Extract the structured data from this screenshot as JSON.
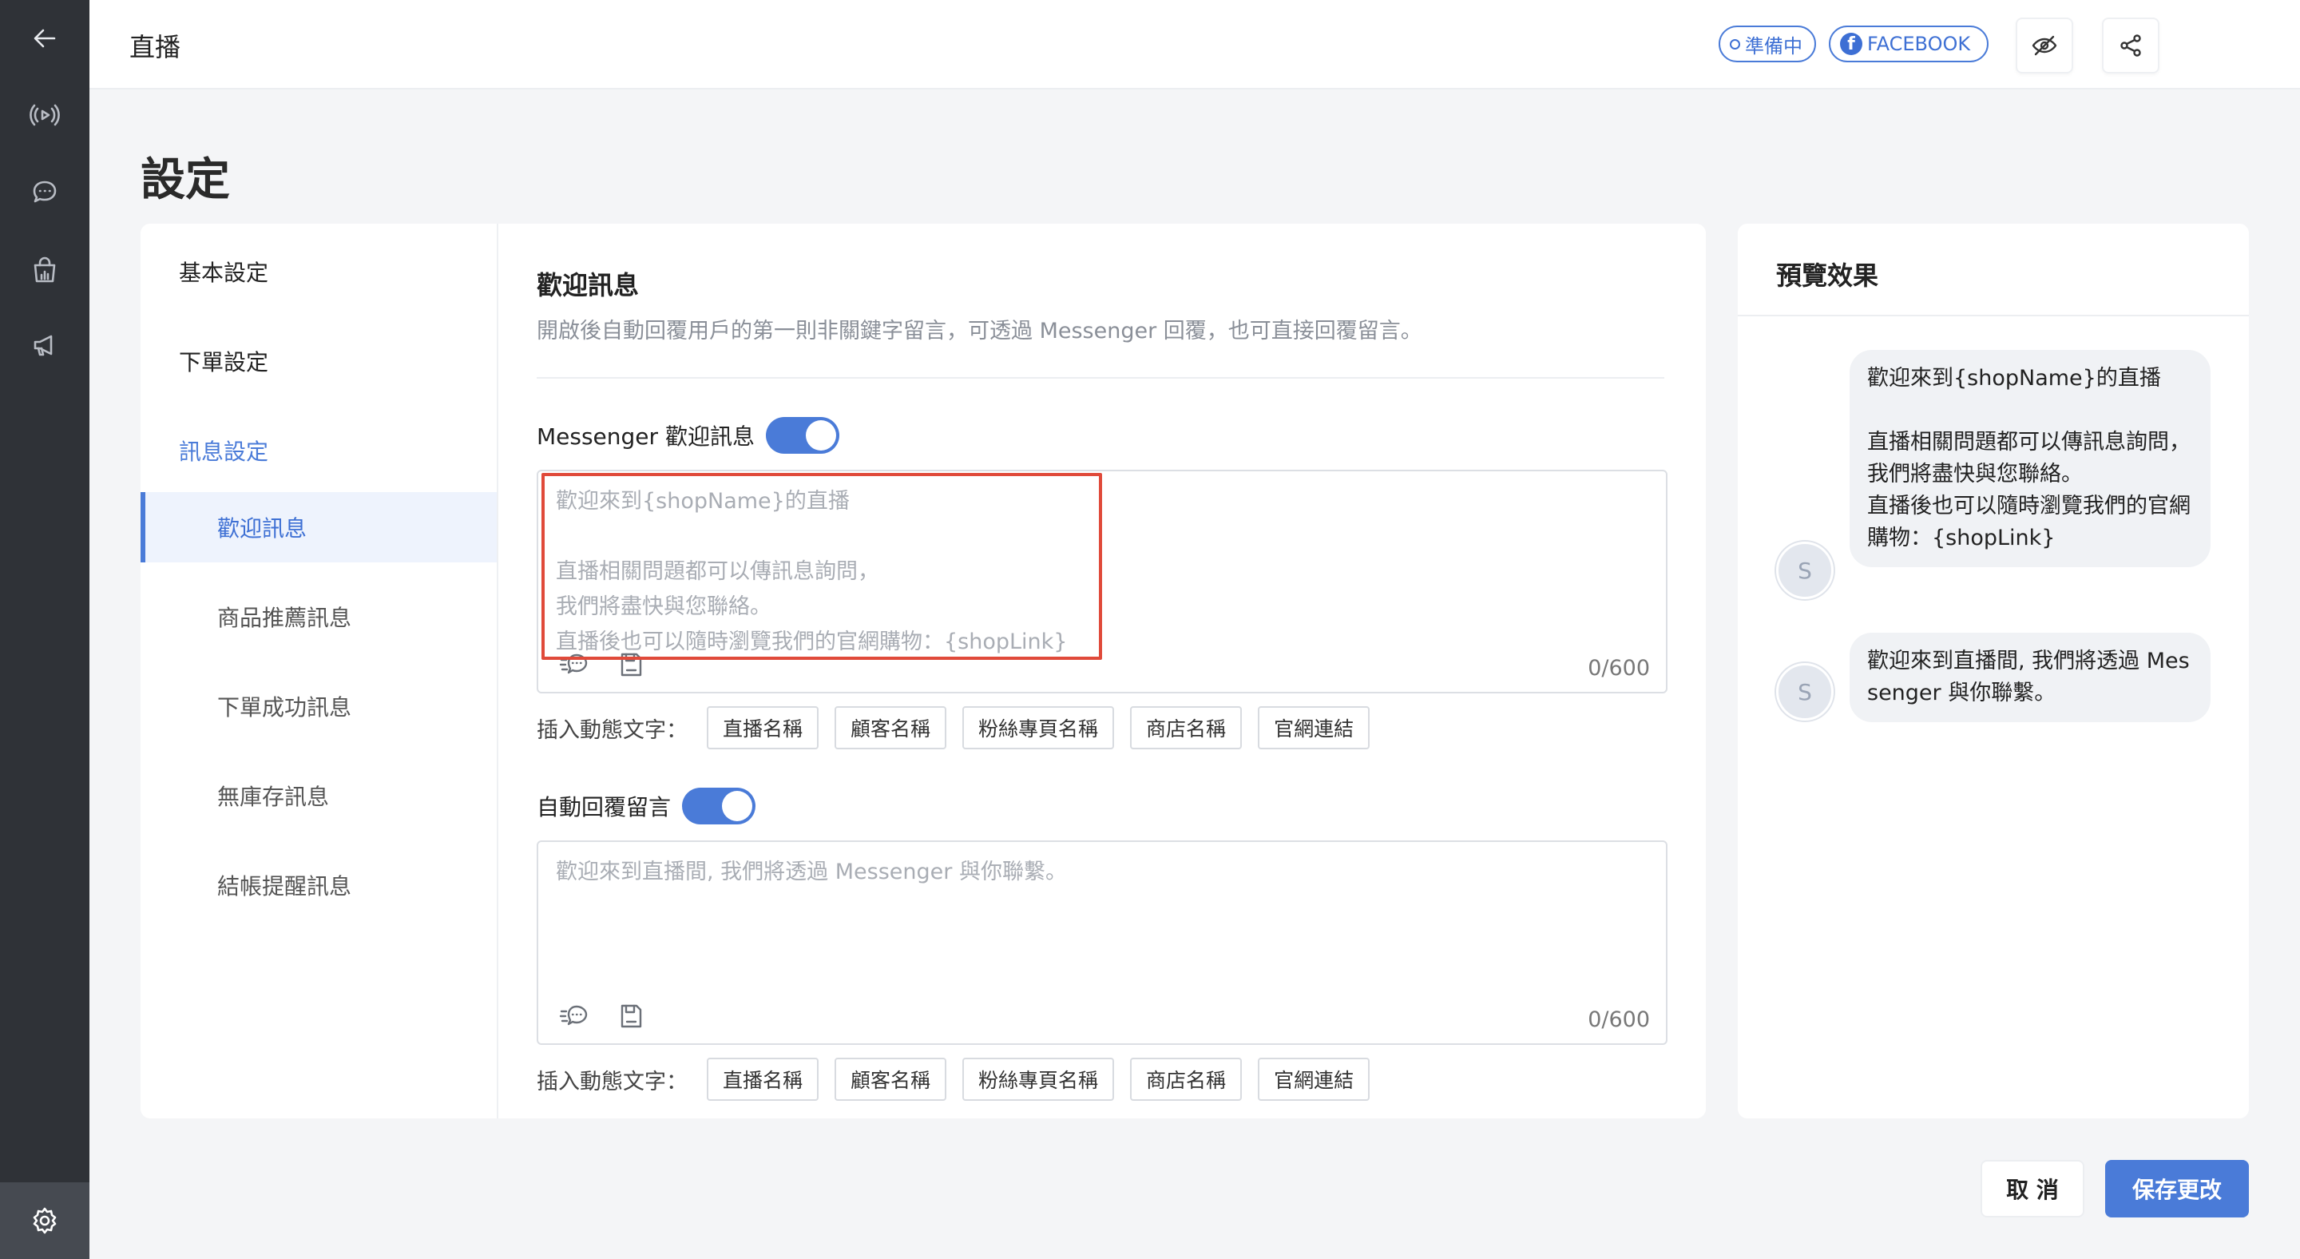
{
  "topbar": {
    "title": "直播",
    "status_label": "準備中",
    "platform_label": "FACEBOOK"
  },
  "rail": {
    "icons": [
      "back-arrow-icon",
      "live-broadcast-icon",
      "chat-bubble-icon",
      "shopping-bag-icon",
      "megaphone-icon",
      "gear-icon"
    ]
  },
  "page": {
    "title": "設定"
  },
  "nav": {
    "items": [
      {
        "label": "基本設定"
      },
      {
        "label": "下單設定"
      },
      {
        "label": "訊息設定"
      },
      {
        "label": "歡迎訊息"
      },
      {
        "label": "商品推薦訊息"
      },
      {
        "label": "下單成功訊息"
      },
      {
        "label": "無庫存訊息"
      },
      {
        "label": "結帳提醒訊息"
      }
    ]
  },
  "section": {
    "title": "歡迎訊息",
    "description": "開啟後自動回覆用戶的第一則非關鍵字留言，可透過 Messenger 回覆，也可直接回覆留言。"
  },
  "messenger": {
    "label": "Messenger 歡迎訊息",
    "placeholder": "歡迎來到{shopName}的直播\n\n直播相關問題都可以傳訊息詢問，\n我們將盡快與您聯絡。\n直播後也可以隨時瀏覽我們的官網購物：{shopLink}",
    "counter": "0/600",
    "enabled": true
  },
  "comment": {
    "label": "自動回覆留言",
    "placeholder": "歡迎來到直播間, 我們將透過 Messenger 與你聯繫。",
    "counter": "0/600",
    "enabled": true
  },
  "insert": {
    "label": "插入動態文字：",
    "chips": [
      "直播名稱",
      "顧客名稱",
      "粉絲專頁名稱",
      "商店名稱",
      "官網連結"
    ]
  },
  "preview": {
    "title": "預覽效果",
    "avatar_letter": "S",
    "bubble1": "歡迎來到{shopName}的直播\n\n直播相關問題都可以傳訊息詢問，\n我們將盡快與您聯絡。\n直播後也可以隨時瀏覽我們的官網購物：{shopLink}",
    "bubble2": "歡迎來到直播間, 我們將透過 Messenger 與你聯繫。"
  },
  "actions": {
    "cancel": "取 消",
    "save": "保存更改"
  },
  "colors": {
    "accent": "#4a7bd8",
    "rail": "#2f3237",
    "highlight": "#e04a3a"
  }
}
